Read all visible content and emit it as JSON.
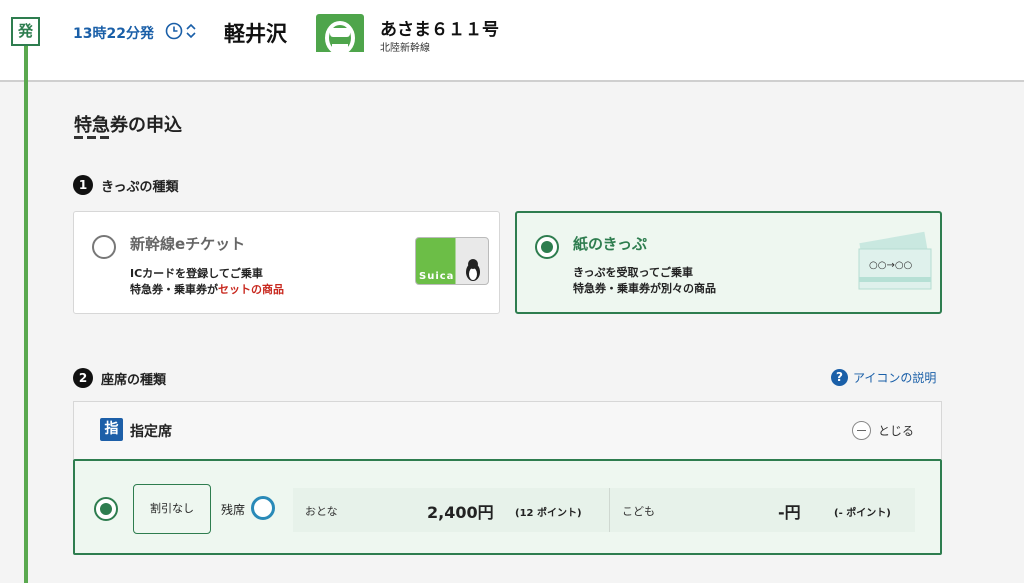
{
  "header": {
    "departure_badge": "発",
    "time": "13時22分発",
    "station": "軽井沢",
    "train_name": "あさま６１１号",
    "train_line": "北陸新幹線"
  },
  "main": {
    "title": "特急券の申込",
    "step1": {
      "number": "1",
      "label": "きっぷの種類",
      "options": [
        {
          "title": "新幹線eチケット",
          "desc_line1": "ICカードを登録してご乗車",
          "desc_line2_prefix": "特急券・乗車券が",
          "desc_line2_highlight": "セットの商品",
          "card_text": "Suica",
          "selected": false
        },
        {
          "title": "紙のきっぷ",
          "desc_line1": "きっぷを受取ってご乗車",
          "desc_line2": "特急券・乗車券が別々の商品",
          "ticket_text": "○○→○○",
          "selected": true
        }
      ]
    },
    "step2": {
      "number": "2",
      "label": "座席の種類",
      "help_icon": "?",
      "help_label": "アイコンの説明"
    },
    "seat_class": {
      "icon_text": "指",
      "title": "指定席",
      "close_label": "とじる"
    },
    "fare": {
      "discount_label": "割引なし",
      "availability_label": "残席",
      "adult_label": "おとな",
      "adult_price": "2,400円",
      "adult_points": "(12 ポイント)",
      "child_label": "こども",
      "child_price": "-円",
      "child_points": "(- ポイント)"
    }
  },
  "colors": {
    "accent_green": "#2e7d4f",
    "route_green": "#5aa84f",
    "link_blue": "#1a5fa8",
    "highlight_red": "#c8281e"
  }
}
